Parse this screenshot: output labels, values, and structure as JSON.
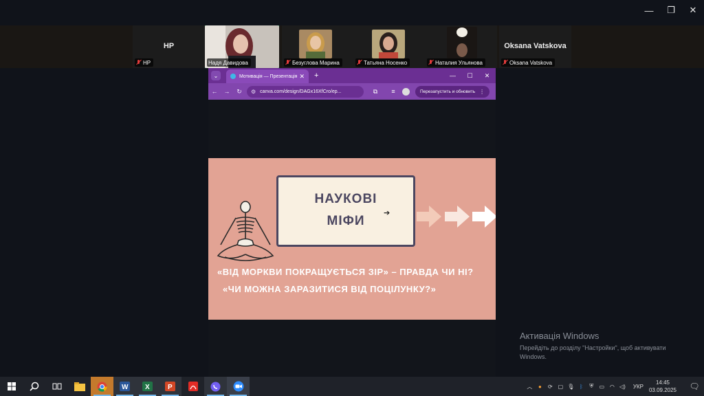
{
  "window_controls": {
    "minimize": "—",
    "restore": "❐",
    "close": "✕"
  },
  "participants": [
    {
      "name": "HP",
      "display": "HP",
      "muted": true
    },
    {
      "name": "Надя Давидова",
      "muted": false,
      "active": true
    },
    {
      "name": "Безуглова Марина",
      "muted": true
    },
    {
      "name": "Татьяна Носенко",
      "muted": true
    },
    {
      "name": "Наталия Ульянова",
      "muted": true
    },
    {
      "name": "Oksana Vatskova",
      "display": "Oksana Vatskova",
      "muted": true
    }
  ],
  "browser": {
    "tab_title": "Мотивація — Презентація",
    "new_tab": "+",
    "address": "canva.com/design/DAGx16XfCro/ep...",
    "relaunch_label": "Перезапустить и обновить",
    "accent": "#8246ae"
  },
  "slide": {
    "title_line1": "НАУКОВІ",
    "title_line2": "МІФИ",
    "text_line1": "«ВІД МОРКВИ ПОКРАЩУЄТЬСЯ ЗІР» – ПРАВДА ЧИ НІ?",
    "text_line2": "«ЧИ МОЖНА ЗАРАЗИТИСЯ ВІД ПОЦІЛУНКУ?»",
    "background": "#e2a394",
    "card_color": "#f9f0e1"
  },
  "activation": {
    "heading": "Активація Windows",
    "subtext": "Перейдіть до розділу \"Настройки\", щоб активувати Windows."
  },
  "taskbar": {
    "language": "УКР",
    "time": "14:45",
    "date": "03.09.2025"
  }
}
